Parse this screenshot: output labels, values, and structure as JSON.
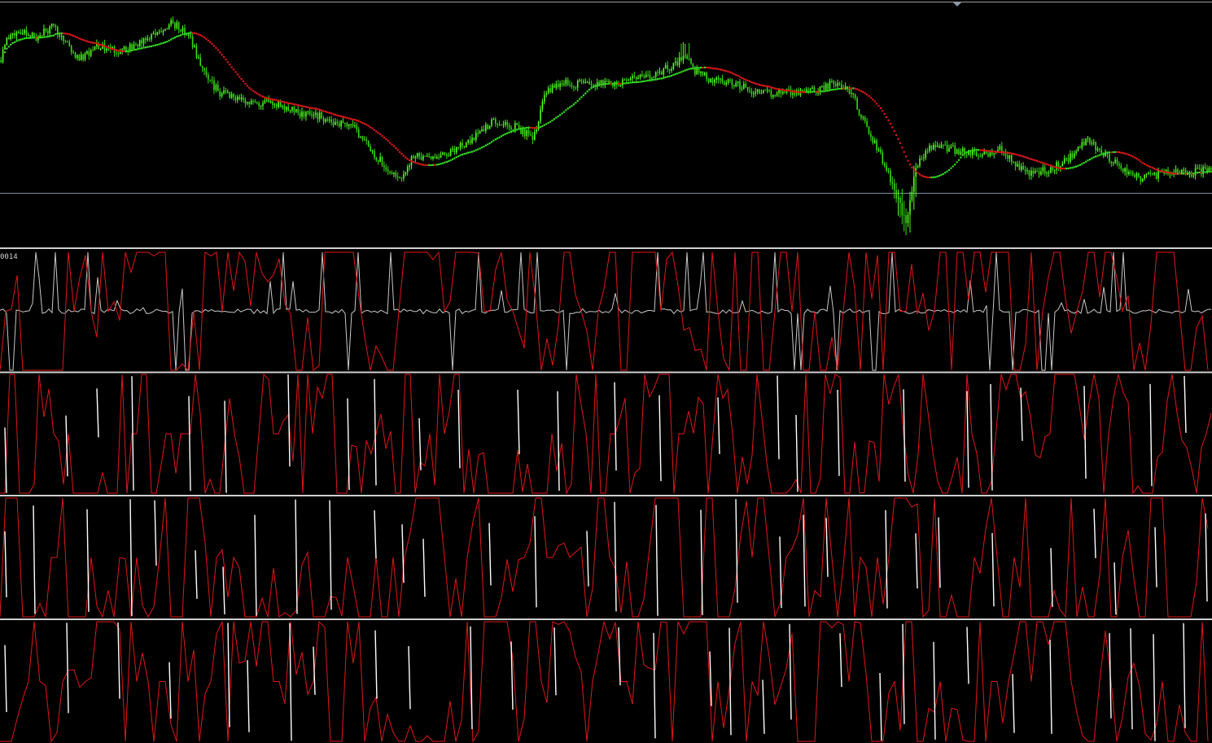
{
  "colors": {
    "background": "#000000",
    "candle_up": "#55ff22",
    "candle_down": "#33dd11",
    "ma_up": "#33dd22",
    "ma_down": "#e01818",
    "osc_primary": "#e01818",
    "osc_secondary": "#c8c8c8",
    "osc_highlight": "#ffffff",
    "separator": "#cfcfcf",
    "level_line": "#7f8f9f"
  },
  "chart_data": [
    {
      "type": "candlestick",
      "panel": "price",
      "title": "",
      "bars": 620,
      "ylim": [
        0,
        1
      ],
      "anchors_x": [
        0,
        6,
        22,
        44,
        63,
        80,
        95,
        118,
        150,
        175,
        198,
        210,
        232,
        245,
        258,
        270,
        292,
        310,
        335,
        360,
        392,
        408,
        432,
        455,
        478,
        490,
        508,
        530,
        560,
        590,
        605,
        630,
        655,
        670,
        690,
        720,
        760,
        800,
        830,
        840,
        850,
        870,
        900,
        930,
        960,
        990,
        1020,
        1045,
        1060,
        1080,
        1095,
        1105,
        1112,
        1125,
        1145,
        1170,
        1200,
        1230,
        1260,
        1290,
        1310,
        1335,
        1350,
        1370,
        1400,
        1430,
        1460,
        1489
      ],
      "anchors_y": [
        0.78,
        0.86,
        0.9,
        0.88,
        0.92,
        0.86,
        0.78,
        0.84,
        0.82,
        0.86,
        0.9,
        0.94,
        0.88,
        0.76,
        0.68,
        0.64,
        0.62,
        0.6,
        0.6,
        0.56,
        0.54,
        0.52,
        0.5,
        0.4,
        0.3,
        0.28,
        0.38,
        0.36,
        0.4,
        0.48,
        0.52,
        0.5,
        0.45,
        0.65,
        0.68,
        0.68,
        0.68,
        0.72,
        0.76,
        0.82,
        0.74,
        0.7,
        0.68,
        0.64,
        0.64,
        0.64,
        0.68,
        0.64,
        0.52,
        0.38,
        0.26,
        0.16,
        0.08,
        0.34,
        0.42,
        0.4,
        0.38,
        0.4,
        0.3,
        0.32,
        0.36,
        0.44,
        0.4,
        0.34,
        0.28,
        0.3,
        0.3,
        0.32
      ],
      "series": [
        {
          "name": "",
          "kind": "candles"
        },
        {
          "name": "",
          "kind": "moving-average",
          "style": "dotted",
          "period": 28
        }
      ]
    },
    {
      "type": "line",
      "panel": "oscillator-1",
      "title": "",
      "label": "0014",
      "ylim": [
        0,
        1
      ],
      "series": [
        {
          "name": "",
          "kind": "oscillator",
          "color": "#c8c8c8",
          "seed": 11
        },
        {
          "name": "",
          "kind": "oscillator",
          "color": "#e01818",
          "seed": 23
        }
      ]
    },
    {
      "type": "line",
      "panel": "oscillator-2",
      "title": "",
      "ylim": [
        0,
        1
      ],
      "series": [
        {
          "name": "",
          "kind": "oscillator",
          "color": "#e01818",
          "seed": 37
        },
        {
          "name": "",
          "kind": "spikes",
          "color": "#ffffff",
          "seed": 41
        }
      ]
    },
    {
      "type": "line",
      "panel": "oscillator-3",
      "title": "",
      "ylim": [
        0,
        1
      ],
      "series": [
        {
          "name": "",
          "kind": "oscillator",
          "color": "#e01818",
          "seed": 53
        },
        {
          "name": "",
          "kind": "spikes",
          "color": "#ffffff",
          "seed": 59
        }
      ]
    },
    {
      "type": "line",
      "panel": "oscillator-4",
      "title": "",
      "ylim": [
        0,
        1
      ],
      "series": [
        {
          "name": "",
          "kind": "oscillator",
          "color": "#e01818",
          "seed": 71
        },
        {
          "name": "",
          "kind": "spikes",
          "color": "#ffffff",
          "seed": 79
        }
      ]
    }
  ]
}
